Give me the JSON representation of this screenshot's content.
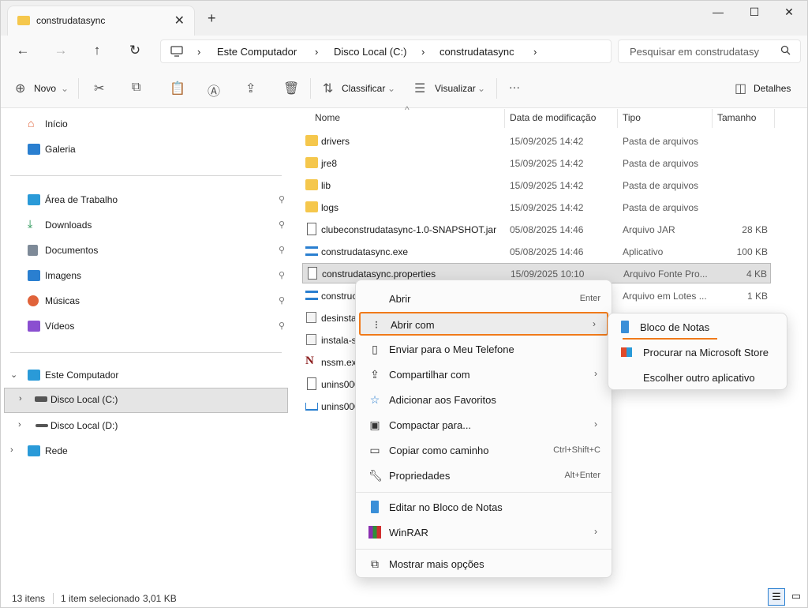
{
  "window": {
    "tab_title": "construdatasync",
    "tab_close": "✕",
    "new_tab": "+",
    "minimize": "—",
    "maximize": "☐",
    "close": "✕"
  },
  "nav": {
    "back": "←",
    "forward": "→",
    "up": "↑",
    "refresh": "↻",
    "breadcrumb": [
      "Este Computador",
      "Disco Local (C:)",
      "construdatasync"
    ],
    "chevron": "›",
    "search_placeholder": "Pesquisar em construdatasy",
    "search_icon": "search-icon"
  },
  "toolbar": {
    "new_label": "Novo",
    "sort_label": "Classificar",
    "view_label": "Visualizar",
    "more_label": "···",
    "details_label": "Detalhes",
    "dropdown": "⌄"
  },
  "sidebar": {
    "top": [
      {
        "label": "Início",
        "icon": "home-icon"
      },
      {
        "label": "Galeria",
        "icon": "gallery-icon"
      }
    ],
    "pinned": [
      {
        "label": "Área de Trabalho",
        "icon": "desktop-icon",
        "color": "#2a9ad8"
      },
      {
        "label": "Downloads",
        "icon": "download-icon",
        "color": "#1d8f4c"
      },
      {
        "label": "Documentos",
        "icon": "documents-icon",
        "color": "#7e8a98"
      },
      {
        "label": "Imagens",
        "icon": "pictures-icon",
        "color": "#2a7fd0"
      },
      {
        "label": "Músicas",
        "icon": "music-icon",
        "color": "#e0633a"
      },
      {
        "label": "Vídeos",
        "icon": "videos-icon",
        "color": "#8a4fd0"
      }
    ],
    "pin_glyph": "📌",
    "tree": [
      {
        "label": "Este Computador",
        "chev": "⌄"
      },
      {
        "label": "Disco Local (C:)",
        "chev": "›"
      },
      {
        "label": "Disco Local (D:)",
        "chev": "›"
      },
      {
        "label": "Rede",
        "chev": "›"
      }
    ]
  },
  "columns": {
    "name": "Nome",
    "date": "Data de modificação",
    "type": "Tipo",
    "size": "Tamanho",
    "sort_indicator": "^"
  },
  "files": [
    {
      "name": "drivers",
      "date": "15/09/2025 14:42",
      "type": "Pasta de arquivos",
      "size": "",
      "icon": "folder-icon"
    },
    {
      "name": "jre8",
      "date": "15/09/2025 14:42",
      "type": "Pasta de arquivos",
      "size": "",
      "icon": "folder-icon"
    },
    {
      "name": "lib",
      "date": "15/09/2025 14:42",
      "type": "Pasta de arquivos",
      "size": "",
      "icon": "folder-icon"
    },
    {
      "name": "logs",
      "date": "15/09/2025 14:42",
      "type": "Pasta de arquivos",
      "size": "",
      "icon": "folder-icon"
    },
    {
      "name": "clubeconstrudatasync-1.0-SNAPSHOT.jar",
      "date": "05/08/2025 14:46",
      "type": "Arquivo JAR",
      "size": "28 KB",
      "icon": "file-icon"
    },
    {
      "name": "construdatasync.exe",
      "date": "05/08/2025 14:46",
      "type": "Aplicativo",
      "size": "100 KB",
      "icon": "exe-icon"
    },
    {
      "name": "construdatasync.properties",
      "date": "15/09/2025 10:10",
      "type": "Arquivo Fonte Pro...",
      "size": "4 KB",
      "icon": "file-icon"
    },
    {
      "name": "construc",
      "date": "",
      "type": "Arquivo em Lotes ...",
      "size": "1 KB",
      "icon": "exe-icon"
    },
    {
      "name": "desinsta",
      "date": "",
      "type": "",
      "size": "",
      "icon": "script-icon"
    },
    {
      "name": "instala-s",
      "date": "",
      "type": "",
      "size": "",
      "icon": "script-icon"
    },
    {
      "name": "nssm.ex",
      "date": "",
      "type": "",
      "size": "",
      "icon": "nssm-icon"
    },
    {
      "name": "unins000",
      "date": "",
      "type": "",
      "size": "",
      "icon": "file-icon"
    },
    {
      "name": "unins000",
      "date": "",
      "type": "",
      "size": "",
      "icon": "uninstall-icon"
    }
  ],
  "context_menu": {
    "items": [
      {
        "label": "Abrir",
        "key": "Enter",
        "arrow": "",
        "icon": ""
      },
      {
        "label": "Abrir com",
        "key": "",
        "arrow": "›",
        "icon": "open-with-icon"
      },
      {
        "label": "Enviar para o Meu Telefone",
        "key": "",
        "arrow": "",
        "icon": "phone-icon"
      },
      {
        "label": "Compartilhar com",
        "key": "",
        "arrow": "›",
        "icon": "share-icon"
      },
      {
        "label": "Adicionar aos Favoritos",
        "key": "",
        "arrow": "",
        "icon": "star-icon"
      },
      {
        "label": "Compactar para...",
        "key": "",
        "arrow": "›",
        "icon": "archive-icon"
      },
      {
        "label": "Copiar como caminho",
        "key": "Ctrl+Shift+C",
        "arrow": "",
        "icon": "copy-path-icon"
      },
      {
        "label": "Propriedades",
        "key": "Alt+Enter",
        "arrow": "",
        "icon": "wrench-icon"
      },
      {
        "label": "Editar no Bloco de Notas",
        "key": "",
        "arrow": "",
        "icon": "notepad-icon"
      },
      {
        "label": "WinRAR",
        "key": "",
        "arrow": "›",
        "icon": "winrar-icon"
      },
      {
        "label": "Mostrar mais opções",
        "key": "",
        "arrow": "",
        "icon": "more-options-icon"
      }
    ]
  },
  "submenu": {
    "items": [
      {
        "label": "Bloco de Notas",
        "icon": "notepad-icon"
      },
      {
        "label": "Procurar na Microsoft Store",
        "icon": "store-icon"
      },
      {
        "label": "Escolher outro aplicativo",
        "icon": ""
      }
    ]
  },
  "status": {
    "count": "13 itens",
    "selected": "1 item selecionado",
    "size": "3,01 KB"
  },
  "colors": {
    "accent": "#f07a1a",
    "folder": "#f5c74c",
    "selection": "#e0e0e0"
  }
}
